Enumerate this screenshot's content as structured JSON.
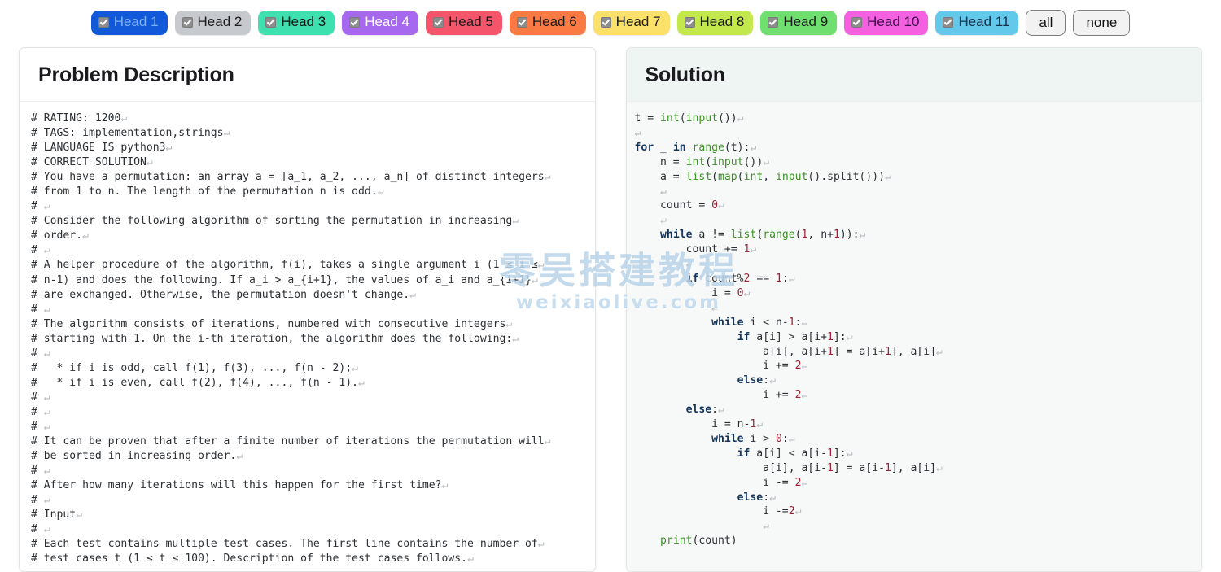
{
  "toolbar": {
    "heads": [
      {
        "label": "Head 1",
        "bg": "#1159d8",
        "fg": "#7fb2ff",
        "checked": true
      },
      {
        "label": "Head 2",
        "bg": "#c6c9cd",
        "fg": "#1b1b1b",
        "checked": true
      },
      {
        "label": "Head 3",
        "bg": "#3fe0b0",
        "fg": "#111111",
        "checked": true
      },
      {
        "label": "Head 4",
        "bg": "#a濃",
        "fg": "#ffffff",
        "checked": true
      },
      {
        "label": "Head 5",
        "bg": "#f4556b",
        "fg": "#1b1b1b",
        "checked": true
      },
      {
        "label": "Head 6",
        "bg": "#fb7a43",
        "fg": "#1b1b1b",
        "checked": true
      },
      {
        "label": "Head 7",
        "bg": "#fbe169",
        "fg": "#1b1b1b",
        "checked": true
      },
      {
        "label": "Head 8",
        "bg": "#c2e84b",
        "fg": "#1b1b1b",
        "checked": true
      },
      {
        "label": "Head 9",
        "bg": "#6fe06f",
        "fg": "#1b1b1b",
        "checked": true
      },
      {
        "label": "Head 10",
        "bg": "#f560e0",
        "fg": "#3b0b4a",
        "checked": true
      },
      {
        "label": "Head 11",
        "bg": "#62c9ea",
        "fg": "#13304a",
        "checked": true
      }
    ],
    "all_label": "all",
    "none_label": "none"
  },
  "problem": {
    "title": "Problem Description",
    "lines": [
      "# RATING: 1200",
      "# TAGS: implementation,strings",
      "# LANGUAGE IS python3",
      "# CORRECT SOLUTION",
      "# You have a permutation: an array a = [a_1, a_2, ..., a_n] of distinct integers",
      "# from 1 to n. The length of the permutation n is odd.",
      "# ",
      "# Consider the following algorithm of sorting the permutation in increasing",
      "# order.",
      "# ",
      "# A helper procedure of the algorithm, f(i), takes a single argument i (1 ≤ i ≤",
      "# n-1) and does the following. If a_i > a_{i+1}, the values of a_i and a_{i+1}",
      "# are exchanged. Otherwise, the permutation doesn't change.",
      "# ",
      "# The algorithm consists of iterations, numbered with consecutive integers",
      "# starting with 1. On the i-th iteration, the algorithm does the following:",
      "# ",
      "#   * if i is odd, call f(1), f(3), ..., f(n - 2);",
      "#   * if i is even, call f(2), f(4), ..., f(n - 1).",
      "# ",
      "# ",
      "# ",
      "# It can be proven that after a finite number of iterations the permutation will",
      "# be sorted in increasing order.",
      "# ",
      "# After how many iterations will this happen for the first time?",
      "# ",
      "# Input",
      "# ",
      "# Each test contains multiple test cases. The first line contains the number of",
      "# test cases t (1 ≤ t ≤ 100). Description of the test cases follows."
    ]
  },
  "solution": {
    "title": "Solution",
    "lines": [
      [
        {
          "t": "t = ",
          "c": ""
        },
        {
          "t": "int",
          "c": "tok-fn"
        },
        {
          "t": "(",
          "c": ""
        },
        {
          "t": "input",
          "c": "tok-fn"
        },
        {
          "t": "())",
          "c": ""
        }
      ],
      [
        {
          "t": "",
          "c": ""
        }
      ],
      [
        {
          "t": "for",
          "c": "tok-kw"
        },
        {
          "t": " _ ",
          "c": ""
        },
        {
          "t": "in",
          "c": "tok-kw"
        },
        {
          "t": " ",
          "c": ""
        },
        {
          "t": "range",
          "c": "tok-fn"
        },
        {
          "t": "(t):",
          "c": ""
        }
      ],
      [
        {
          "t": "    n = ",
          "c": ""
        },
        {
          "t": "int",
          "c": "tok-fn"
        },
        {
          "t": "(",
          "c": ""
        },
        {
          "t": "input",
          "c": "tok-fn"
        },
        {
          "t": "())",
          "c": ""
        }
      ],
      [
        {
          "t": "    a = ",
          "c": ""
        },
        {
          "t": "list",
          "c": "tok-fn"
        },
        {
          "t": "(",
          "c": ""
        },
        {
          "t": "map",
          "c": "tok-fn"
        },
        {
          "t": "(",
          "c": ""
        },
        {
          "t": "int",
          "c": "tok-fn"
        },
        {
          "t": ", ",
          "c": ""
        },
        {
          "t": "input",
          "c": "tok-fn"
        },
        {
          "t": "().split()))",
          "c": ""
        }
      ],
      [
        {
          "t": "    ",
          "c": ""
        }
      ],
      [
        {
          "t": "    count = ",
          "c": ""
        },
        {
          "t": "0",
          "c": "tok-num"
        }
      ],
      [
        {
          "t": "    ",
          "c": ""
        }
      ],
      [
        {
          "t": "    ",
          "c": ""
        },
        {
          "t": "while",
          "c": "tok-kw"
        },
        {
          "t": " a != ",
          "c": ""
        },
        {
          "t": "list",
          "c": "tok-fn"
        },
        {
          "t": "(",
          "c": ""
        },
        {
          "t": "range",
          "c": "tok-fn"
        },
        {
          "t": "(",
          "c": ""
        },
        {
          "t": "1",
          "c": "tok-num"
        },
        {
          "t": ", n+",
          "c": ""
        },
        {
          "t": "1",
          "c": "tok-num"
        },
        {
          "t": ")):",
          "c": ""
        }
      ],
      [
        {
          "t": "        count += ",
          "c": ""
        },
        {
          "t": "1",
          "c": "tok-num"
        }
      ],
      [
        {
          "t": "        ",
          "c": ""
        }
      ],
      [
        {
          "t": "        ",
          "c": ""
        },
        {
          "t": "if",
          "c": "tok-kw"
        },
        {
          "t": " count%",
          "c": ""
        },
        {
          "t": "2",
          "c": "tok-num"
        },
        {
          "t": " == ",
          "c": ""
        },
        {
          "t": "1",
          "c": "tok-num"
        },
        {
          "t": ":",
          "c": ""
        }
      ],
      [
        {
          "t": "            i = ",
          "c": ""
        },
        {
          "t": "0",
          "c": "tok-num"
        }
      ],
      [
        {
          "t": "            ",
          "c": ""
        }
      ],
      [
        {
          "t": "            ",
          "c": ""
        },
        {
          "t": "while",
          "c": "tok-kw"
        },
        {
          "t": " i < n-",
          "c": ""
        },
        {
          "t": "1",
          "c": "tok-num"
        },
        {
          "t": ":",
          "c": ""
        }
      ],
      [
        {
          "t": "                ",
          "c": ""
        },
        {
          "t": "if",
          "c": "tok-kw"
        },
        {
          "t": " a[i] > a[i+",
          "c": ""
        },
        {
          "t": "1",
          "c": "tok-num"
        },
        {
          "t": "]:",
          "c": ""
        }
      ],
      [
        {
          "t": "                    a[i], a[i+",
          "c": ""
        },
        {
          "t": "1",
          "c": "tok-num"
        },
        {
          "t": "] = a[i+",
          "c": ""
        },
        {
          "t": "1",
          "c": "tok-num"
        },
        {
          "t": "], a[i]",
          "c": ""
        }
      ],
      [
        {
          "t": "                    i += ",
          "c": ""
        },
        {
          "t": "2",
          "c": "tok-num"
        }
      ],
      [
        {
          "t": "                ",
          "c": ""
        },
        {
          "t": "else",
          "c": "tok-kw"
        },
        {
          "t": ":",
          "c": ""
        }
      ],
      [
        {
          "t": "                    i += ",
          "c": ""
        },
        {
          "t": "2",
          "c": "tok-num"
        }
      ],
      [
        {
          "t": "        ",
          "c": ""
        },
        {
          "t": "else",
          "c": "tok-kw"
        },
        {
          "t": ":",
          "c": ""
        }
      ],
      [
        {
          "t": "            i = n-",
          "c": ""
        },
        {
          "t": "1",
          "c": "tok-num"
        }
      ],
      [
        {
          "t": "            ",
          "c": ""
        },
        {
          "t": "while",
          "c": "tok-kw"
        },
        {
          "t": " i > ",
          "c": ""
        },
        {
          "t": "0",
          "c": "tok-num"
        },
        {
          "t": ":",
          "c": ""
        }
      ],
      [
        {
          "t": "                ",
          "c": ""
        },
        {
          "t": "if",
          "c": "tok-kw"
        },
        {
          "t": " a[i] < a[i-",
          "c": ""
        },
        {
          "t": "1",
          "c": "tok-num"
        },
        {
          "t": "]:",
          "c": ""
        }
      ],
      [
        {
          "t": "                    a[i], a[i-",
          "c": ""
        },
        {
          "t": "1",
          "c": "tok-num"
        },
        {
          "t": "] = a[i-",
          "c": ""
        },
        {
          "t": "1",
          "c": "tok-num"
        },
        {
          "t": "], a[i]",
          "c": ""
        }
      ],
      [
        {
          "t": "                    i -= ",
          "c": ""
        },
        {
          "t": "2",
          "c": "tok-num"
        }
      ],
      [
        {
          "t": "                ",
          "c": ""
        },
        {
          "t": "else",
          "c": "tok-kw"
        },
        {
          "t": ":",
          "c": ""
        }
      ],
      [
        {
          "t": "                    i -=",
          "c": ""
        },
        {
          "t": "2",
          "c": "tok-num"
        }
      ],
      [
        {
          "t": "                    ",
          "c": ""
        }
      ],
      [
        {
          "t": "    ",
          "c": ""
        },
        {
          "t": "print",
          "c": "tok-fn"
        },
        {
          "t": "(count)",
          "c": "",
          "nocr": true
        }
      ]
    ]
  },
  "watermark": {
    "line1": "零吴搭建教程",
    "line2": "weixiaolive.com"
  }
}
